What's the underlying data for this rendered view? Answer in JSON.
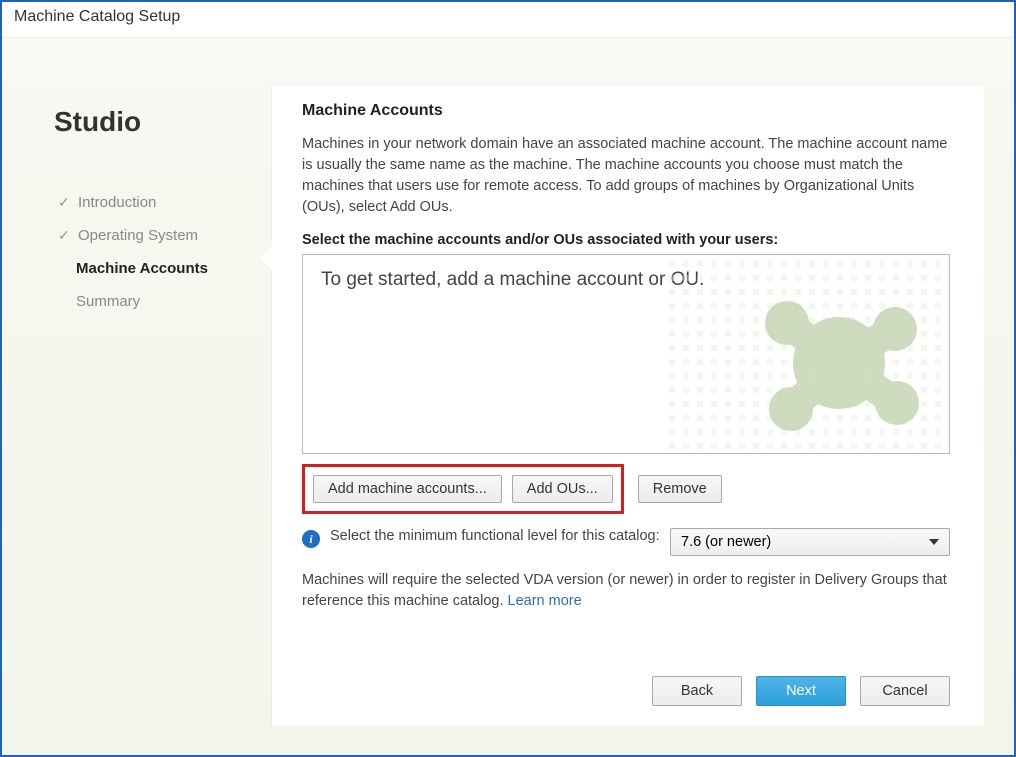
{
  "window": {
    "title": "Machine Catalog Setup"
  },
  "sidebar": {
    "title": "Studio",
    "items": [
      {
        "label": "Introduction",
        "done": true
      },
      {
        "label": "Operating System",
        "done": true
      },
      {
        "label": "Machine Accounts",
        "active": true
      },
      {
        "label": "Summary"
      }
    ]
  },
  "panel": {
    "heading": "Machine Accounts",
    "description": "Machines in your network domain have an associated machine account. The machine account name is usually the same name as the machine. The machine accounts you choose must match the machines that users use for remote access. To add groups of machines by Organizational Units (OUs), select Add OUs.",
    "select_label": "Select the machine accounts and/or OUs associated with your users:",
    "listbox_placeholder": "To get started, add a machine account or OU.",
    "buttons": {
      "add_accounts": "Add machine accounts...",
      "add_ous": "Add OUs...",
      "remove": "Remove"
    },
    "functional_label": "Select the minimum functional level for this catalog:",
    "functional_value": "7.6 (or newer)",
    "note_prefix": "Machines will require the selected VDA version (or newer) in order to register in Delivery Groups that reference this machine catalog. ",
    "learn_more": "Learn more"
  },
  "footer": {
    "back": "Back",
    "next": "Next",
    "cancel": "Cancel"
  }
}
